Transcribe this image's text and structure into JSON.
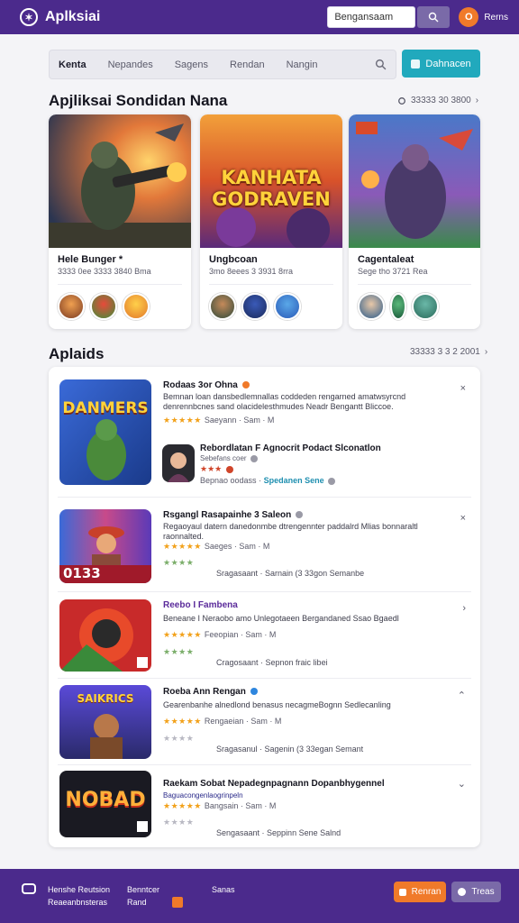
{
  "header": {
    "brand": "Aplksiai",
    "search_placeholder": "Bengansaam",
    "user_initial": "O",
    "user_name": "Rerns"
  },
  "nav": {
    "items": [
      "Kenta",
      "Nepandes",
      "Sagens",
      "Rendan",
      "Nangin"
    ],
    "cta_label": "Dahnacen"
  },
  "featured": {
    "title": "Apjliksai Sondidan Nana",
    "link_text": "33333 30 3800",
    "cards": [
      {
        "title": "Hele Bunger *",
        "meta": "3333 0ee 3333 3840 Bma",
        "art_text": ""
      },
      {
        "title": "Ungbcoan",
        "meta": "3mo 8eees 3 3931 8rra",
        "art_text": "KANHATA GODRAVEN"
      },
      {
        "title": "Cagentaleat",
        "meta": "Sege tho 3721 Rea",
        "art_text": ""
      }
    ]
  },
  "apps": {
    "title": "Aplaids",
    "link_text": "33333 3 3 2 2001",
    "rows": [
      {
        "title": "Rodaas 3or Ohna",
        "desc": "Bemnan loan dansbedlemnallas coddeden rengarned amatwsyrcnd denrennbcnes sand olacidelesthmudes Neadr Bengantt Bliccoe.",
        "stars": "★★★★★",
        "count": "Saeyann · Sam · M",
        "icon_text": "DANMERS",
        "sub": {
          "title": "Rebordlatan F Agnocrit Podact Slconatlon",
          "line": "Sebefans coer",
          "stars": "★★★",
          "foot": "Bepnao oodass",
          "foot_accent": "Spedanen Sene"
        }
      },
      {
        "title": "Rsgangl Rasapainhe 3 Saleon",
        "desc": "Regaoyaul datern danedonmbe dtrengennter paddalrd Mlias bonnaraltl raonnalted.",
        "stars": "★★★★★",
        "count": "Saeges · Sam · M",
        "green": "★★★★",
        "foot": "Sragasaant · Sarnain (3 33gon Semanbe",
        "icon_text": "0133"
      },
      {
        "title": "Reebo I Fambena",
        "desc": "Beneane I Neraobo amo Unlegotaeen Bergandaned Ssao Bgaedl",
        "stars": "★★★★★",
        "count": "Feeopian · Sam · M",
        "green": "★★★★",
        "foot": "Cragosaant · Sepnon fraic libei",
        "icon_text": ""
      },
      {
        "title": "Roeba Ann Rengan",
        "desc": "Gearenbanhe alnedlond benasus necagmeBognn Sedlecanling",
        "stars": "★★★★★",
        "count": "Rengaeian · Sam · M",
        "grey": "★★★★",
        "foot": "Sragasanul · Sagenin (3 33egan Semant",
        "icon_text": "SAIKRICS"
      },
      {
        "title": "Raekam Sobat Nepadegnpagnann Dopanbhygennel",
        "desc": "Baguacongenlaogrinpeln",
        "stars": "★★★★★",
        "count": "Bangsain · Sam · M",
        "grey": "★★★★",
        "foot": "Sengasaant · Seppinn Sene Salnd",
        "icon_text": "NOBAD"
      }
    ]
  },
  "footer": {
    "col1_line1": "Henshe Reutsion",
    "col1_line2": "Reaeanbnsteras",
    "col2_line1": "Benntcer",
    "col2_line2": "Rand",
    "col3_line1": "Sanas",
    "btn_orange": "Renran",
    "btn_purple": "Treas"
  },
  "colors": {
    "topbar": "#4b2a8c",
    "accent": "#21a9bd",
    "orange": "#f07a2a",
    "star": "#f2a11a"
  }
}
